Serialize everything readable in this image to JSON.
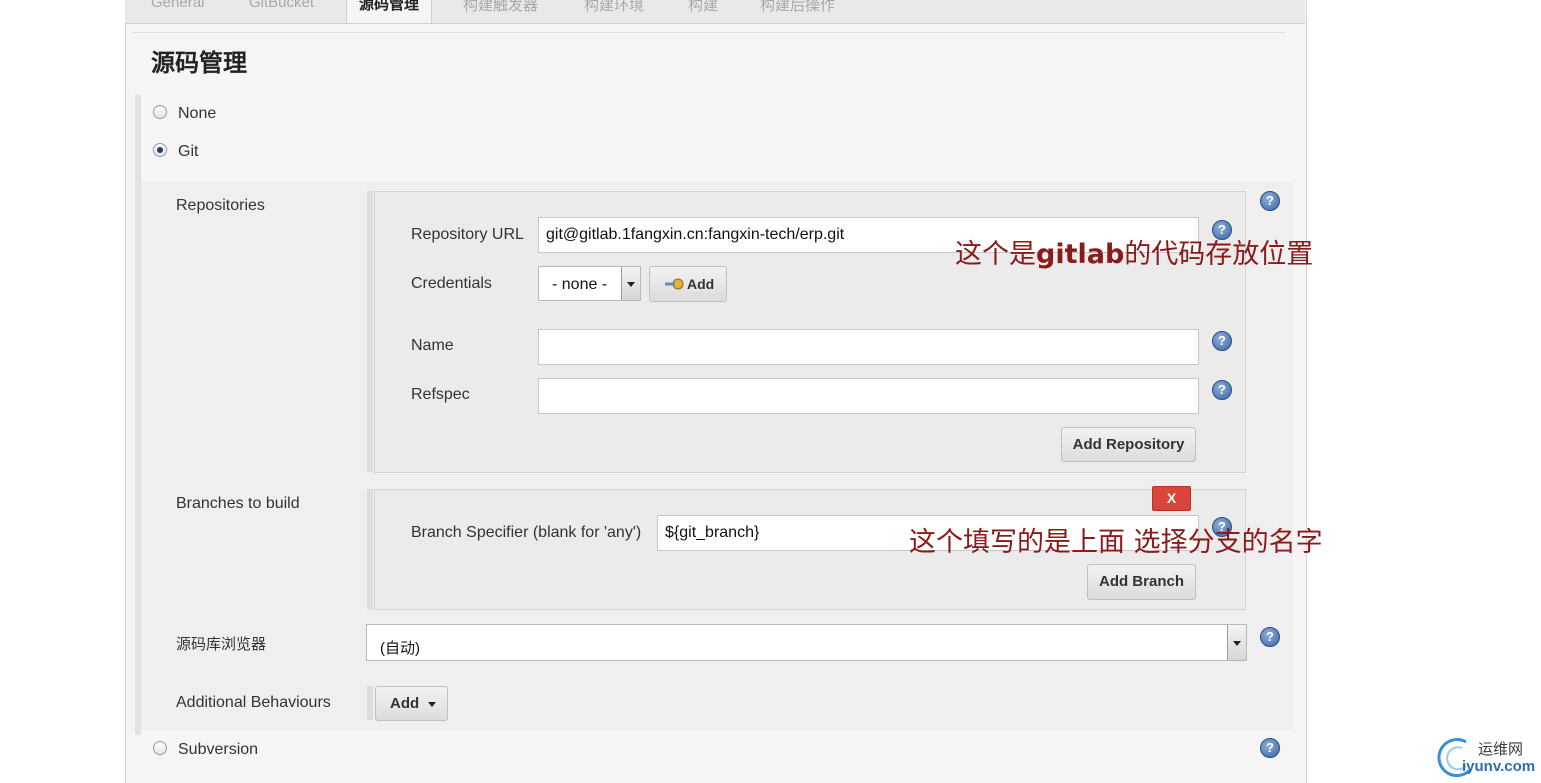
{
  "tabs": [
    "General",
    "GitBucket",
    "源码管理",
    "构建触发器",
    "构建环境",
    "构建",
    "构建后操作"
  ],
  "section_title": "源码管理",
  "scm_options": {
    "none": "None",
    "git": "Git",
    "subversion": "Subversion"
  },
  "repositories": {
    "label": "Repositories",
    "url_label": "Repository URL",
    "url_value": "git@gitlab.1fangxin.cn:fangxin-tech/erp.git",
    "credentials_label": "Credentials",
    "credentials_value": "- none -",
    "credentials_add": "Add",
    "name_label": "Name",
    "name_value": "",
    "refspec_label": "Refspec",
    "refspec_value": "",
    "add_repository": "Add Repository"
  },
  "branches": {
    "label": "Branches to build",
    "specifier_label": "Branch Specifier (blank for 'any')",
    "specifier_value": "${git_branch}",
    "delete": "X",
    "add_branch": "Add Branch"
  },
  "browser": {
    "label": "源码库浏览器",
    "value": "(自动)"
  },
  "behaviours": {
    "label": "Additional Behaviours",
    "add": "Add"
  },
  "annotations": {
    "url_note_pre": "这个是",
    "url_note_mid": "gitlab",
    "url_note_post": "的代码存放位置",
    "branch_note": "这个填写的是上面 选择分支的名字"
  },
  "watermark": {
    "cn": "运维网",
    "en": "iyunv.com"
  },
  "colors": {
    "annotation": "#8b1a1a",
    "help": "#3a63a0",
    "delete": "#d9443b"
  }
}
